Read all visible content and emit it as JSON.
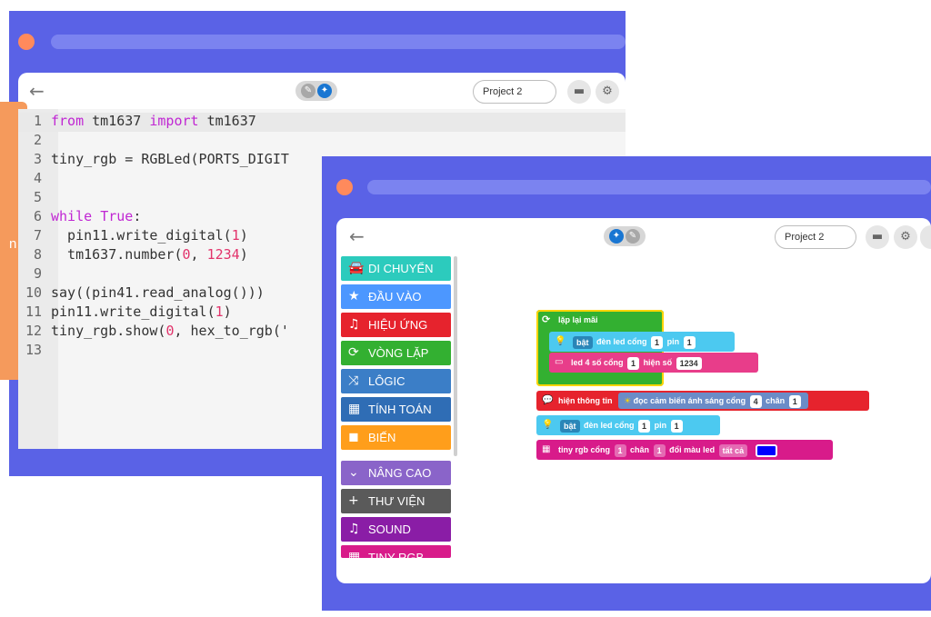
{
  "colors": {
    "window_frame": "#5a62e6",
    "dot": "#ff8a5c",
    "accent": "#1976d2"
  },
  "back_window": {
    "back_icon": "←",
    "toggle_left_icon": "text-icon",
    "toggle_right_icon": "blocks-icon",
    "project_name": "Project 2",
    "folder_icon": "folder-icon",
    "settings_icon": "gear-icon",
    "side_tab_letter": "n",
    "code_lines": [
      {
        "n": "1",
        "parts": [
          [
            "kw",
            "from"
          ],
          [
            "t",
            " tm1637 "
          ],
          [
            "kw",
            "import"
          ],
          [
            "t",
            " tm1637"
          ]
        ]
      },
      {
        "n": "2",
        "parts": []
      },
      {
        "n": "3",
        "parts": [
          [
            "t",
            "tiny_rgb = RGBLed(PORTS_DIGIT"
          ]
        ]
      },
      {
        "n": "4",
        "parts": []
      },
      {
        "n": "5",
        "parts": []
      },
      {
        "n": "6",
        "parts": [
          [
            "kw",
            "while"
          ],
          [
            "t",
            " "
          ],
          [
            "kw",
            "True"
          ],
          [
            "t",
            ":"
          ]
        ]
      },
      {
        "n": "7",
        "parts": [
          [
            "t",
            "  pin11.write_digital("
          ],
          [
            "num",
            "1"
          ],
          [
            "t",
            ")"
          ]
        ]
      },
      {
        "n": "8",
        "parts": [
          [
            "t",
            "  tm1637.number("
          ],
          [
            "num",
            "0"
          ],
          [
            "t",
            ", "
          ],
          [
            "num",
            "1234"
          ],
          [
            "t",
            ")"
          ]
        ]
      },
      {
        "n": "9",
        "parts": []
      },
      {
        "n": "10",
        "parts": [
          [
            "t",
            "say((pin41.read_analog()))"
          ]
        ]
      },
      {
        "n": "11",
        "parts": [
          [
            "t",
            "pin11.write_digital("
          ],
          [
            "num",
            "1"
          ],
          [
            "t",
            ")"
          ]
        ]
      },
      {
        "n": "12",
        "parts": [
          [
            "t",
            "tiny_rgb.show("
          ],
          [
            "num",
            "0"
          ],
          [
            "t",
            ", hex_to_rgb('"
          ]
        ]
      },
      {
        "n": "13",
        "parts": []
      }
    ]
  },
  "front_window": {
    "back_icon": "←",
    "project_name": "Project 2",
    "categories": [
      {
        "label": "DI CHUYỂN",
        "color": "#2ccbbd",
        "icon": "car-icon",
        "glyph": "🚘"
      },
      {
        "label": "ĐẦU VÀO",
        "color": "#4c97ff",
        "icon": "star-icon",
        "glyph": "★"
      },
      {
        "label": "HIỆU ỨNG",
        "color": "#e6232d",
        "icon": "music-icon",
        "glyph": "♫"
      },
      {
        "label": "VÒNG LẶP",
        "color": "#33b031",
        "icon": "loop-icon",
        "glyph": "⟳"
      },
      {
        "label": "LÔGIC",
        "color": "#3b7ec7",
        "icon": "shuffle-icon",
        "glyph": "⤨"
      },
      {
        "label": "TÍNH TOÁN",
        "color": "#2f6db5",
        "icon": "calculator-icon",
        "glyph": "▦"
      },
      {
        "label": "BIẾN",
        "color": "#ff9e1b",
        "icon": "save-icon",
        "glyph": "◼"
      },
      {
        "label": "NÂNG CAO",
        "color": "#8a64c9",
        "icon": "chevron-down-icon",
        "glyph": "⌄"
      },
      {
        "label": "THƯ VIỆN",
        "color": "#5a5a5a",
        "icon": "plus-icon",
        "glyph": "+"
      },
      {
        "label": "SOUND",
        "color": "#8a1da6",
        "icon": "music-icon",
        "glyph": "♫"
      },
      {
        "label": "TINY RGB",
        "color": "#d81b8a",
        "icon": "led-icon",
        "glyph": "▦"
      }
    ],
    "blocks": {
      "loop": {
        "label": "lặp lại mãi",
        "color": "#33b031"
      },
      "led_on_1": {
        "word": "bật",
        "text": "đèn led cổng",
        "port": "1",
        "pin_label": "pin",
        "pin": "1",
        "color": "#4cc9f0"
      },
      "led4": {
        "text": "led 4 số cổng",
        "port": "1",
        "show_label": "hiện số",
        "value": "1234",
        "color": "#e83d8a"
      },
      "show_info": {
        "text": "hiện thông tin",
        "sensor": "đọc cảm biến ánh sáng cổng",
        "port": "4",
        "pin_label": "chân",
        "pin": "1",
        "color": "#e6232d"
      },
      "led_on_2": {
        "word": "bật",
        "text": "đèn led cổng",
        "port": "1",
        "pin_label": "pin",
        "pin": "1",
        "color": "#4cc9f0"
      },
      "tiny_rgb": {
        "text": "tiny rgb cổng",
        "port": "1",
        "pin_label": "chân",
        "pin": "1",
        "change": "đổi màu led",
        "all": "tất cả",
        "led_color": "#0000ff",
        "color": "#d81b8a"
      }
    }
  }
}
